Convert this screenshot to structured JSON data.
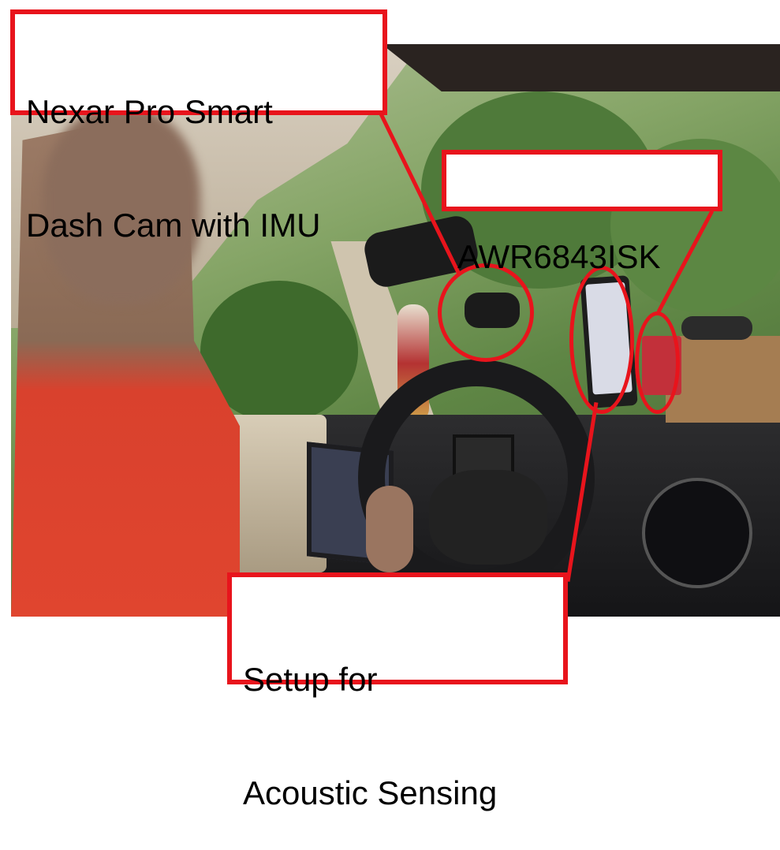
{
  "labels": {
    "dashcam": {
      "line1": "Nexar Pro Smart",
      "line2": "Dash Cam with IMU"
    },
    "radar": {
      "text": "AWR6843ISK"
    },
    "acoustic": {
      "line1": "Setup for",
      "line2": "Acoustic Sensing"
    }
  },
  "colors": {
    "annotation_red": "#e8141c",
    "label_bg": "#ffffff",
    "label_text": "#000000"
  }
}
